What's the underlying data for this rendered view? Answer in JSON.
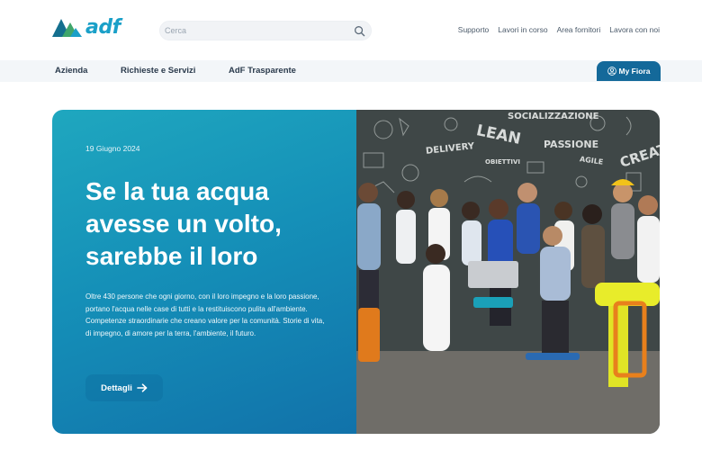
{
  "header": {
    "logo_text": "adf",
    "search_placeholder": "Cerca",
    "links": [
      "Supporto",
      "Lavori in corso",
      "Area fornitori",
      "Lavora con noi"
    ]
  },
  "nav": {
    "items": [
      "Azienda",
      "Richieste e Servizi",
      "AdF Trasparente"
    ],
    "account_button": "My Fiora"
  },
  "hero": {
    "date": "19 Giugno 2024",
    "title": "Se la tua acqua avesse un volto, sarebbe il loro",
    "body": "Oltre 430 persone che ogni giorno, con il loro impegno e la loro passione, portano l'acqua nelle case di tutti e la restituiscono pulita all'ambiente. Competenze straordinarie che creano valore per la comunità. Storie di vita, di impegno, di amore per la terra, l'ambiente, il futuro.",
    "button": "Dettagli",
    "photo_words": [
      "SOCIALIZZAZIONE",
      "LEAN",
      "PASSIONE",
      "DELIVERY",
      "CREAT",
      "AGILE",
      "OBIETTIVI"
    ]
  },
  "colors": {
    "brand_blue": "#1aa0c8",
    "logo_dark": "#146f8e",
    "logo_green": "#3fa66b",
    "account_button": "#14699a",
    "hero_gradient_start": "#1fa7bf",
    "hero_gradient_end": "#1172aa"
  },
  "icons": {
    "search": "search-icon",
    "account": "user-icon",
    "details": "arrow-right-icon"
  }
}
